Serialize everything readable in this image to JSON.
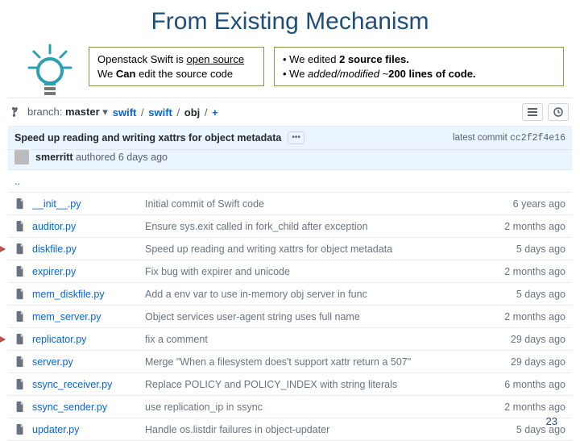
{
  "title": "From Existing Mechanism",
  "callout1_line1a": "Openstack Swift is ",
  "callout1_line1b": "open source",
  "callout1_line2a": "We ",
  "callout1_line2b": "Can",
  "callout1_line2c": " edit the source code",
  "callout2_line1a": "• We edited ",
  "callout2_line1b": "2 source files.",
  "callout2_line2a": "• We ",
  "callout2_line2b": "added/modified",
  "callout2_line2c": " ~",
  "callout2_line2d": "200 lines of code.",
  "branch_label": "branch: ",
  "branch_name": "master",
  "crumb1": "swift",
  "crumb2": "swift",
  "crumb3": "obj",
  "crumb_sep": "/",
  "crumb_plus": "+",
  "commit_msg": "Speed up reading and writing xattrs for object metadata",
  "commit_author": "smerritt",
  "commit_authed": " authored 6 days ago",
  "commit_sha_label": "latest commit ",
  "commit_sha": "cc2f2f4e16",
  "parent_row": "..",
  "files": [
    {
      "name": "__init__.py",
      "msg": "Initial commit of Swift code",
      "time": "6 years ago",
      "arrow": false
    },
    {
      "name": "auditor.py",
      "msg": "Ensure sys.exit called in fork_child after exception",
      "time": "2 months ago",
      "arrow": false
    },
    {
      "name": "diskfile.py",
      "msg": "Speed up reading and writing xattrs for object metadata",
      "time": "5 days ago",
      "arrow": true
    },
    {
      "name": "expirer.py",
      "msg": "Fix bug with expirer and unicode",
      "time": "2 months ago",
      "arrow": false
    },
    {
      "name": "mem_diskfile.py",
      "msg": "Add a env var to use in-memory obj server in func",
      "time": "5 days ago",
      "arrow": false
    },
    {
      "name": "mem_server.py",
      "msg": "Object services user-agent string uses full name",
      "time": "2 months ago",
      "arrow": false
    },
    {
      "name": "replicator.py",
      "msg": "fix a comment",
      "time": "29 days ago",
      "arrow": true
    },
    {
      "name": "server.py",
      "msg": "Merge \"When a filesystem does't support xattr return a 507\"",
      "time": "29 days ago",
      "arrow": false
    },
    {
      "name": "ssync_receiver.py",
      "msg": "Replace POLICY and POLICY_INDEX with string literals",
      "time": "6 months ago",
      "arrow": false
    },
    {
      "name": "ssync_sender.py",
      "msg": "use replication_ip in ssync",
      "time": "2 months ago",
      "arrow": false
    },
    {
      "name": "updater.py",
      "msg": "Handle os.listdir failures in object-updater",
      "time": "5 days ago",
      "arrow": false
    }
  ],
  "page_number": "23"
}
